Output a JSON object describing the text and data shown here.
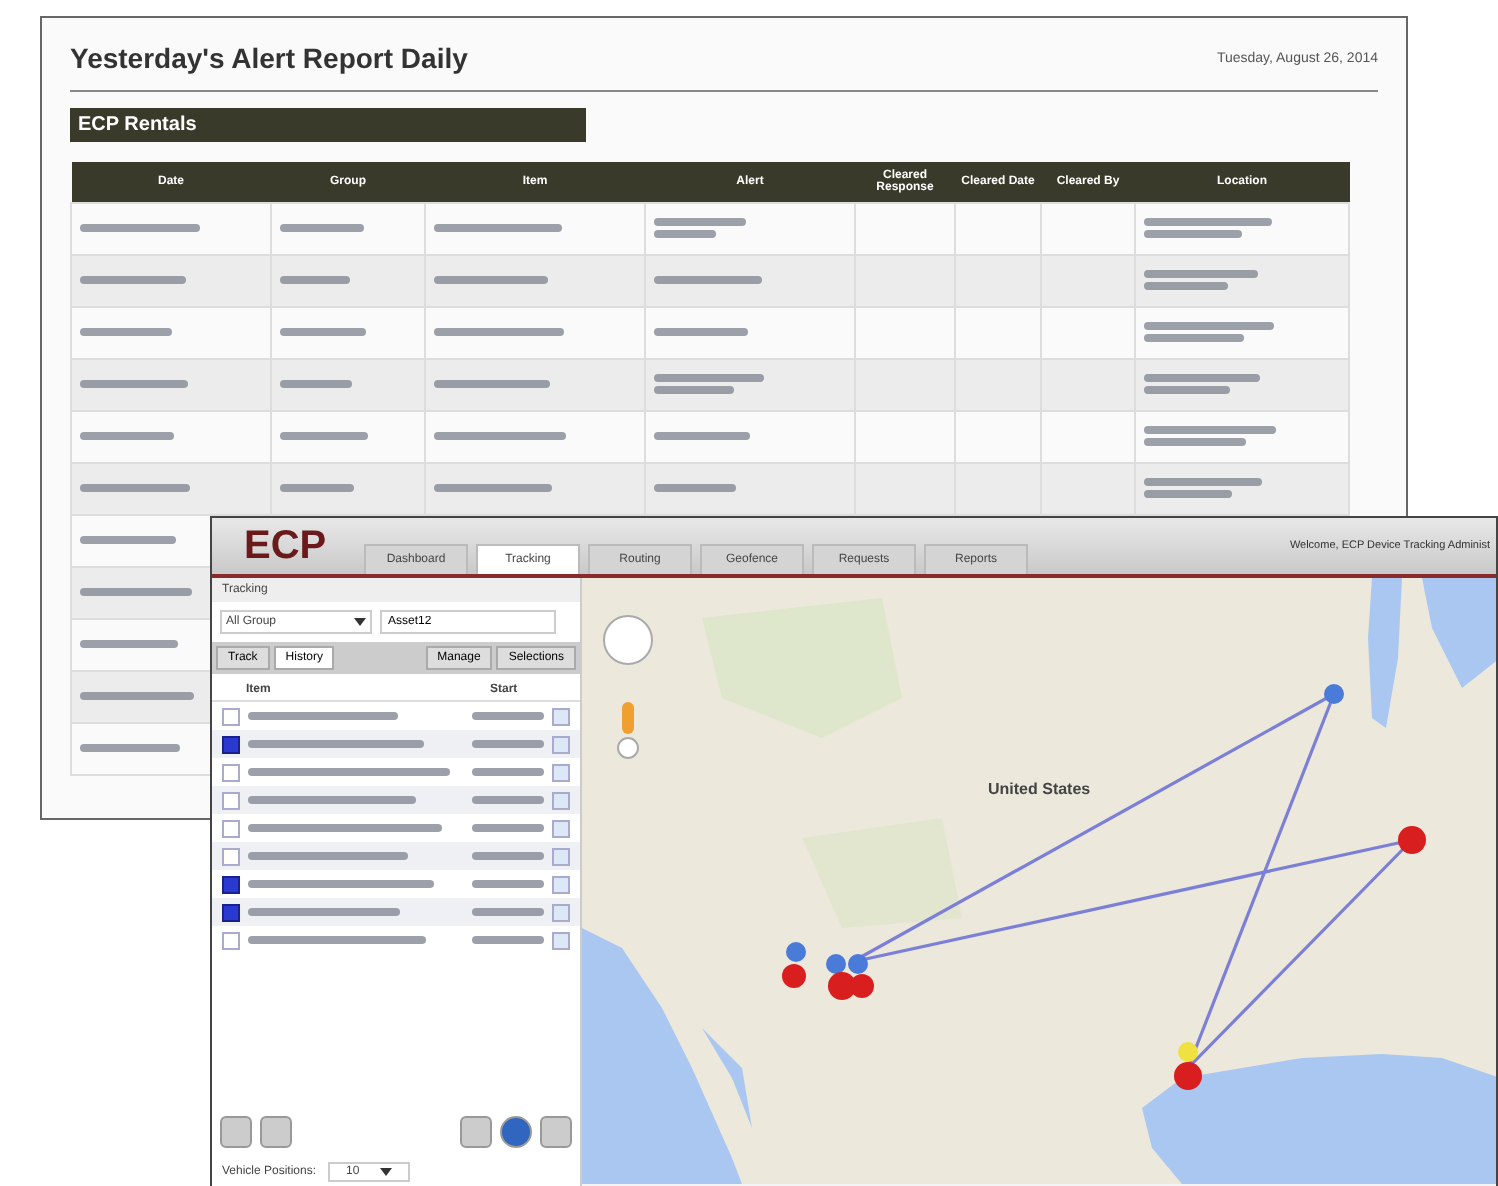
{
  "report": {
    "title": "Yesterday's Alert Report Daily",
    "date": "Tuesday, August 26, 2014",
    "section": "ECP Rentals",
    "columns": [
      "Date",
      "Group",
      "Item",
      "Alert",
      "Cleared Response",
      "Cleared Date",
      "Cleared By",
      "Location"
    ]
  },
  "app": {
    "logo": "ECP",
    "tabs": [
      {
        "label": "Dashboard",
        "selected": false
      },
      {
        "label": "Tracking",
        "selected": true
      },
      {
        "label": "Routing",
        "selected": false
      },
      {
        "label": "Geofence",
        "selected": false
      },
      {
        "label": "Requests",
        "selected": false
      },
      {
        "label": "Reports",
        "selected": false
      }
    ],
    "welcome": "Welcome, ECP Device Tracking Administ",
    "sidebar": {
      "title": "Tracking",
      "group": "All Group",
      "search_value": "Asset12",
      "subtabs": [
        {
          "label": "Track",
          "selected": false
        },
        {
          "label": "History",
          "selected": true
        }
      ],
      "actions": [
        "Manage",
        "Selections"
      ],
      "columns": [
        "Item",
        "Start"
      ],
      "items": [
        {
          "checked": false
        },
        {
          "checked": true
        },
        {
          "checked": false
        },
        {
          "checked": false
        },
        {
          "checked": false
        },
        {
          "checked": false
        },
        {
          "checked": true
        },
        {
          "checked": true
        },
        {
          "checked": false
        }
      ],
      "footer_label": "Vehicle Positions:",
      "footer_value": "10"
    },
    "map": {
      "label": "United States"
    }
  }
}
